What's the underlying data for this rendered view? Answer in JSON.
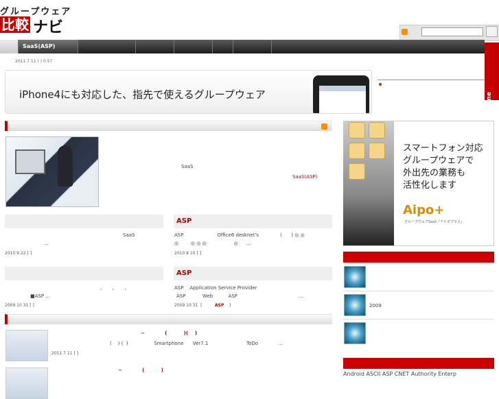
{
  "logo": {
    "top": "グループウェア",
    "box": "比較",
    "rest": "ナビ"
  },
  "nav": {
    "active": "SaaS(ASP)"
  },
  "follow": "Follow me",
  "updated": "2011 7 11 ( ) 0 57",
  "banner": {
    "text": "iPhone4にも対応した、指先で使えるグループウェア"
  },
  "featured": {
    "saas": "SaaS",
    "link": "SaaS(ASP)"
  },
  "articles": [
    {
      "heading": "",
      "body": "SaaS",
      "body2": "...",
      "date": "2010 9 22  [        ]"
    },
    {
      "heading": "ASP",
      "body": "ASP                      Office6 desknet's              (      ) ◎ ◎",
      "body2": "◎        ◎ ◎ ◎                  ◎     ...",
      "date": "2010 8 10  [        ]"
    },
    {
      "heading": "",
      "body": ",       ,       ,",
      "body2": "■ASP   ...",
      "date": "2009 10 31  [        ]"
    },
    {
      "heading": "ASP",
      "body": "ASP    Application Service Provider",
      "body2": "ASP           Web          ASP                                        ...",
      "date": "2009 10 31  [",
      "tag": "ASP",
      "close": "]"
    }
  ],
  "list": [
    {
      "title": "−            (          )(    )",
      "meta": "(    ) (  )                 Smartphone      Ver7.1                         ToDo             ...",
      "date": "2011 7 11  [        ]"
    },
    {
      "title": "−            (          )",
      "meta": "",
      "date": ""
    }
  ],
  "ad": {
    "lines": [
      "スマートフォン対応",
      "グループウェアで",
      "外出先の業務も",
      "活性化します"
    ],
    "logo": "Aipo+",
    "sub": "グループウェアSaaS「アイポプラス」"
  },
  "sidebar": {
    "item2": "2009",
    "bottom": "Android ASCII ASP CNET  Authority Enterp"
  }
}
